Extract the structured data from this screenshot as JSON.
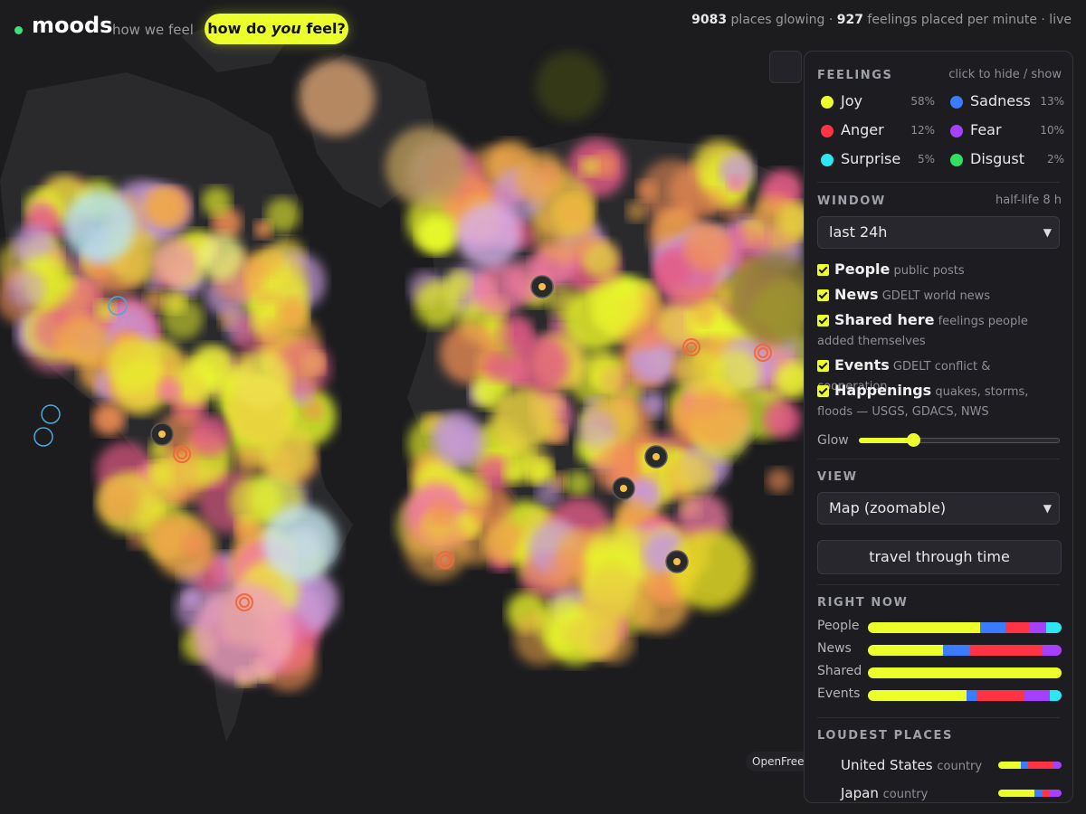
{
  "header": {
    "brand": "moods",
    "tagline": "how we feel",
    "cta_pre": "how do ",
    "cta_em": "you",
    "cta_post": " feel?",
    "stats_places": "9083",
    "stats_places_label": " places glowing · ",
    "stats_feelings": "927",
    "stats_feelings_label": " feelings placed per minute · live"
  },
  "attribution": "OpenFree",
  "colors": {
    "joy": "#ecff2a",
    "sadness": "#3a7bff",
    "anger": "#ff3344",
    "fear": "#a540ff",
    "surprise": "#2ee6f2",
    "disgust": "#30e060"
  },
  "feelings": {
    "title": "FEELINGS",
    "hint": "click to hide / show",
    "items": [
      {
        "name": "Joy",
        "pct": "58%",
        "color": "#ecff2a"
      },
      {
        "name": "Sadness",
        "pct": "13%",
        "color": "#3a7bff"
      },
      {
        "name": "Anger",
        "pct": "12%",
        "color": "#ff3344"
      },
      {
        "name": "Fear",
        "pct": "10%",
        "color": "#a540ff"
      },
      {
        "name": "Surprise",
        "pct": "5%",
        "color": "#2ee6f2"
      },
      {
        "name": "Disgust",
        "pct": "2%",
        "color": "#30e060"
      }
    ]
  },
  "window": {
    "title": "WINDOW",
    "hint": "half-life 8 h",
    "selected": "last 24h"
  },
  "sources": [
    {
      "name": "People",
      "desc": "public posts",
      "checked": true
    },
    {
      "name": "News",
      "desc": "GDELT world news",
      "checked": true
    },
    {
      "name": "Shared here",
      "desc": "feelings people added themselves",
      "checked": true
    },
    {
      "name": "Events",
      "desc": "GDELT conflict & cooperation",
      "checked": true
    },
    {
      "name": "Happenings",
      "desc": "quakes, storms, floods — USGS, GDACS, NWS",
      "checked": true
    }
  ],
  "glow": {
    "label": "Glow",
    "value": 0.27
  },
  "view": {
    "title": "VIEW",
    "selected": "Map (zoomable)",
    "time_button": "travel through time"
  },
  "right_now": {
    "title": "RIGHT NOW",
    "rows": [
      {
        "label": "People",
        "mix": [
          [
            "joy",
            0.58
          ],
          [
            "sadness",
            0.13
          ],
          [
            "anger",
            0.12
          ],
          [
            "fear",
            0.09
          ],
          [
            "surprise",
            0.08
          ]
        ]
      },
      {
        "label": "News",
        "mix": [
          [
            "joy",
            0.39
          ],
          [
            "sadness",
            0.14
          ],
          [
            "anger",
            0.37
          ],
          [
            "fear",
            0.1
          ]
        ]
      },
      {
        "label": "Shared",
        "mix": [
          [
            "joy",
            1.0
          ]
        ]
      },
      {
        "label": "Events",
        "mix": [
          [
            "joy",
            0.51
          ],
          [
            "sadness",
            0.05
          ],
          [
            "anger",
            0.25
          ],
          [
            "fear",
            0.13
          ],
          [
            "surprise",
            0.06
          ]
        ]
      }
    ]
  },
  "loudest": {
    "title": "LOUDEST PLACES",
    "rows": [
      {
        "name": "United States",
        "kind": "country",
        "mix": [
          [
            "joy",
            0.35
          ],
          [
            "sadness",
            0.12
          ],
          [
            "anger",
            0.4
          ],
          [
            "fear",
            0.13
          ]
        ]
      },
      {
        "name": "Japan",
        "kind": "country",
        "mix": [
          [
            "joy",
            0.57
          ],
          [
            "sadness",
            0.13
          ],
          [
            "anger",
            0.1
          ],
          [
            "fear",
            0.2
          ]
        ]
      }
    ]
  }
}
